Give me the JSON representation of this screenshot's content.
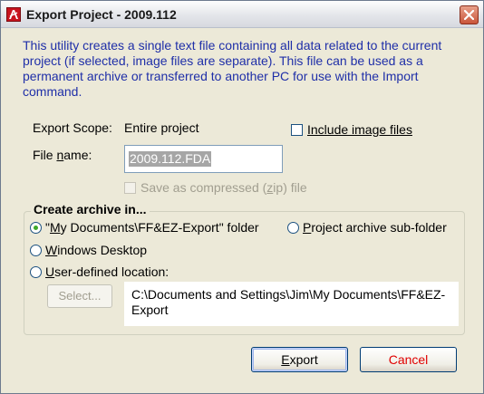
{
  "window": {
    "title": "Export Project - 2009.112",
    "icon": "app-logo-icon",
    "close_icon": "close-icon"
  },
  "description": "This utility creates a single text file containing all data related to the current project (if selected, image files are separate).  This file can be used as a permanent archive or transferred to another PC for use with the Import command.",
  "scope": {
    "label": "Export Scope:",
    "value": "Entire project"
  },
  "include_images": {
    "label": "Include image files",
    "checked": false
  },
  "file_name": {
    "label_prefix": "File ",
    "label_mnemonic": "n",
    "label_suffix": "ame:",
    "value": "2009.112.FDA"
  },
  "compress": {
    "label_prefix": "Save as compressed (",
    "label_mnemonic": "z",
    "label_suffix": "ip) file",
    "checked": false,
    "enabled": false
  },
  "archive_group": {
    "title": "Create archive in...",
    "options": [
      {
        "prefix": "\"",
        "mnemonic": "M",
        "suffix": "y Documents\\FF&EZ-Export\" folder",
        "selected": true
      },
      {
        "prefix": "",
        "mnemonic": "P",
        "suffix": "roject archive sub-folder",
        "selected": false
      },
      {
        "prefix": "",
        "mnemonic": "W",
        "suffix": "indows Desktop",
        "selected": false
      },
      {
        "prefix": "",
        "mnemonic": "U",
        "suffix": "ser-defined location:",
        "selected": false
      }
    ],
    "select_button": "Select...",
    "location": "C:\\Documents and Settings\\Jim\\My Documents\\FF&EZ-Export"
  },
  "buttons": {
    "export_mnemonic": "E",
    "export_rest": "xport",
    "cancel": "Cancel"
  },
  "colors": {
    "description_text": "#1f2fa8",
    "cancel_text": "#e00000",
    "selected_radio": "#3ea828",
    "filename_selection": "#a6a6a6"
  }
}
